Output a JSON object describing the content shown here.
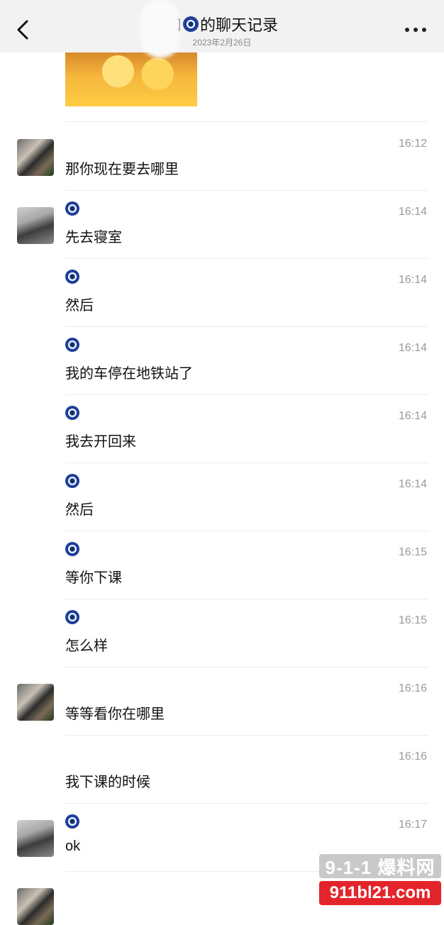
{
  "header": {
    "title_prefix": "和",
    "title_suffix": "的聊天记录",
    "date": "2023年2月26日"
  },
  "messages": [
    {
      "text": "那你现在要去哪里",
      "time": "16:12"
    },
    {
      "text": "先去寝室",
      "time": "16:14"
    },
    {
      "text": "然后",
      "time": "16:14"
    },
    {
      "text": "我的车停在地铁站了",
      "time": "16:14"
    },
    {
      "text": "我去开回来",
      "time": "16:14"
    },
    {
      "text": "然后",
      "time": "16:14"
    },
    {
      "text": "等你下课",
      "time": "16:15"
    },
    {
      "text": "怎么样",
      "time": "16:15"
    },
    {
      "text": "等等看你在哪里",
      "time": "16:16"
    },
    {
      "text": "我下课的时候",
      "time": "16:16"
    },
    {
      "text": "ok",
      "time": "16:17"
    }
  ],
  "watermark": {
    "line1": "9-1-1 爆料网",
    "line2": "911bl21.com"
  },
  "icons": [
    "back-icon",
    "more-icon",
    "evil-eye-icon"
  ]
}
